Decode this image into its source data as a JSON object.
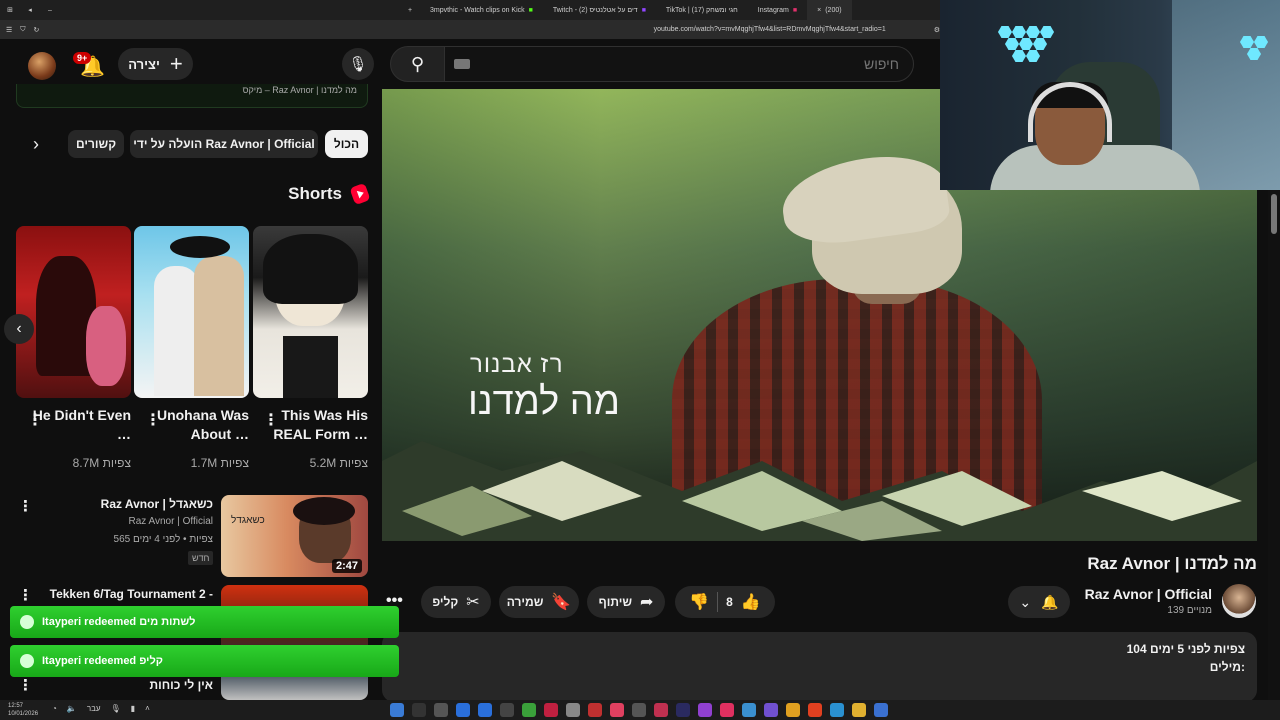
{
  "browser": {
    "tabs": [
      {
        "label": "3mpvthic - Watch clips on Kick",
        "color": "#53fc18"
      },
      {
        "label": "Twitch - (2) דים על אטלנטיס",
        "color": "#9146ff"
      },
      {
        "label": "TikTok | חגי ומשחק (17)",
        "color": "#ffffff"
      },
      {
        "label": "Instagram",
        "color": "#e1306c"
      },
      {
        "label": "(200)",
        "color": "#ff0000"
      }
    ],
    "url": "youtube.com/watch?v=mvMqghjTfw4&list=RDmvMqghjTfw4&start_radio=1"
  },
  "header": {
    "notification_count": "9+",
    "create_label": "יצירה",
    "search_placeholder": "חיפוש"
  },
  "sidebar": {
    "mix_text": "מיקס – Raz Avnor | מה למדנו",
    "chips": [
      "הכול",
      "הועלה על ידי Raz Avnor | Official",
      "קשורים"
    ],
    "shorts_title": "Shorts",
    "shorts": [
      {
        "title": "This Was His REAL Form …",
        "views": "5.2M צפיות"
      },
      {
        "title": "Unohana Was About …",
        "views": "1.7M צפיות"
      },
      {
        "title": "He Didn't Even …",
        "views": "8.7M צפיות"
      }
    ],
    "recommended": [
      {
        "title": "Raz Avnor | כשאגדל",
        "channel": "Raz Avnor | Official",
        "meta": "565 צפיות • לפני 4 ימים",
        "badge": "חדש",
        "duration": "2:47"
      },
      {
        "title": "Tekken 6/Tag Tournament 2 -",
        "channel": "אין לי כוחות"
      }
    ]
  },
  "video": {
    "overlay_artist": "רז אבנור",
    "overlay_song": "מה למדנו",
    "title": "Raz Avnor | מה למדנו",
    "channel": "Raz Avnor | Official",
    "subscribers": "139 מנויים",
    "likes": "8",
    "share_label": "שיתוף",
    "save_label": "שמירה",
    "clip_label": "קליפ",
    "views_line": "104 צפיות  לפני 5 ימים",
    "desc_line2": "מילים:"
  },
  "redeems": [
    "Itayperi redeemed לשתות מים",
    "Itayperi redeemed קליפ"
  ],
  "taskbar": {
    "time": "12:57",
    "date": "10/01/2026",
    "lang": "עבר"
  }
}
